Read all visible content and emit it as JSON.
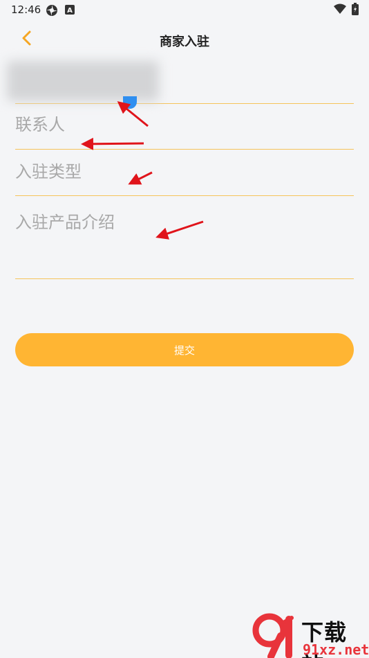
{
  "status_bar": {
    "time": "12:46",
    "left_icons": [
      "app-notification-icon",
      "a-badge-icon"
    ],
    "right_icons": [
      "wifi-icon",
      "battery-icon"
    ]
  },
  "header": {
    "title": "商家入驻",
    "back_icon": "chevron-left-icon",
    "accent_color": "#f5a623"
  },
  "form": {
    "merchant_name": {
      "value": "",
      "blurred": true
    },
    "contact": {
      "placeholder": "联系人",
      "value": ""
    },
    "entry_type": {
      "placeholder": "入驻类型",
      "value": ""
    },
    "product_intro": {
      "placeholder": "入驻产品介绍",
      "value": ""
    },
    "underline_color": "#f5c35a"
  },
  "submit": {
    "label": "提交",
    "color": "#ffb533"
  },
  "annotations": {
    "arrow_color": "#e0141b",
    "count": 4
  },
  "watermark": {
    "brand": "下载站",
    "domain": "91xz.net",
    "logo_icon": "91-logo-icon"
  }
}
